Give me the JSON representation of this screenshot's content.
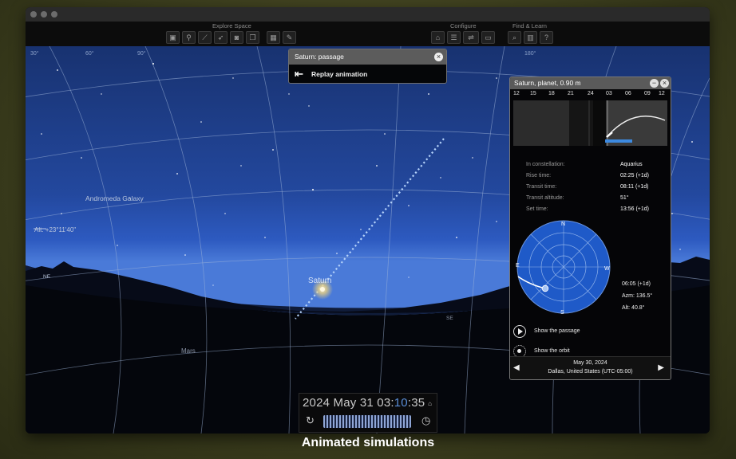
{
  "toolbar": {
    "groups": {
      "explore": "Explore Space",
      "configure": "Configure",
      "find": "Find & Learn"
    }
  },
  "sky": {
    "labels": {
      "andromeda": "Andromeda Galaxy",
      "altitude": "Alt: +23°11'40\"",
      "saturn": "Saturn",
      "mars": "Mars",
      "ne": "NE",
      "se": "SE",
      "grid_top": [
        "30°",
        "60°",
        "90°",
        "180°"
      ]
    }
  },
  "passage_panel": {
    "title": "Saturn: passage",
    "replay_label": "Replay animation"
  },
  "saturn_panel": {
    "title": "Saturn, planet, 0.90 m",
    "hours": [
      "12",
      "15",
      "18",
      "21",
      "24",
      "03",
      "06",
      "09",
      "12"
    ],
    "info": [
      {
        "key": "In constellation:",
        "value": "Aquarius"
      },
      {
        "key": "Rise time:",
        "value": "02:25 (+1d)"
      },
      {
        "key": "Transit time:",
        "value": "08:11 (+1d)"
      },
      {
        "key": "Transit altitude:",
        "value": "51°"
      },
      {
        "key": "Set time:",
        "value": "13:56 (+1d)"
      }
    ],
    "compass": {
      "n": "N",
      "e": "E",
      "w": "W",
      "s": "S"
    },
    "position": {
      "time": "06:05 (+1d)",
      "azm": "Azm: 136.5°",
      "alt": "Alt: 40.8°"
    },
    "actions": {
      "passage": "Show the passage",
      "orbit": "Show the orbit"
    },
    "date": "May 30, 2024",
    "location": "Dallas, United States (UTC-05:00)"
  },
  "time_widget": {
    "prefix": "2024  May 31  03:",
    "minutes": "10",
    "seconds": ":35"
  },
  "caption": "Animated simulations",
  "colors": {
    "sky_top": "#1d3c82",
    "sky_horizon": "#2b56b4",
    "highlight_blue": "#5a8ed8",
    "path_dots": "#a8c8f5"
  }
}
